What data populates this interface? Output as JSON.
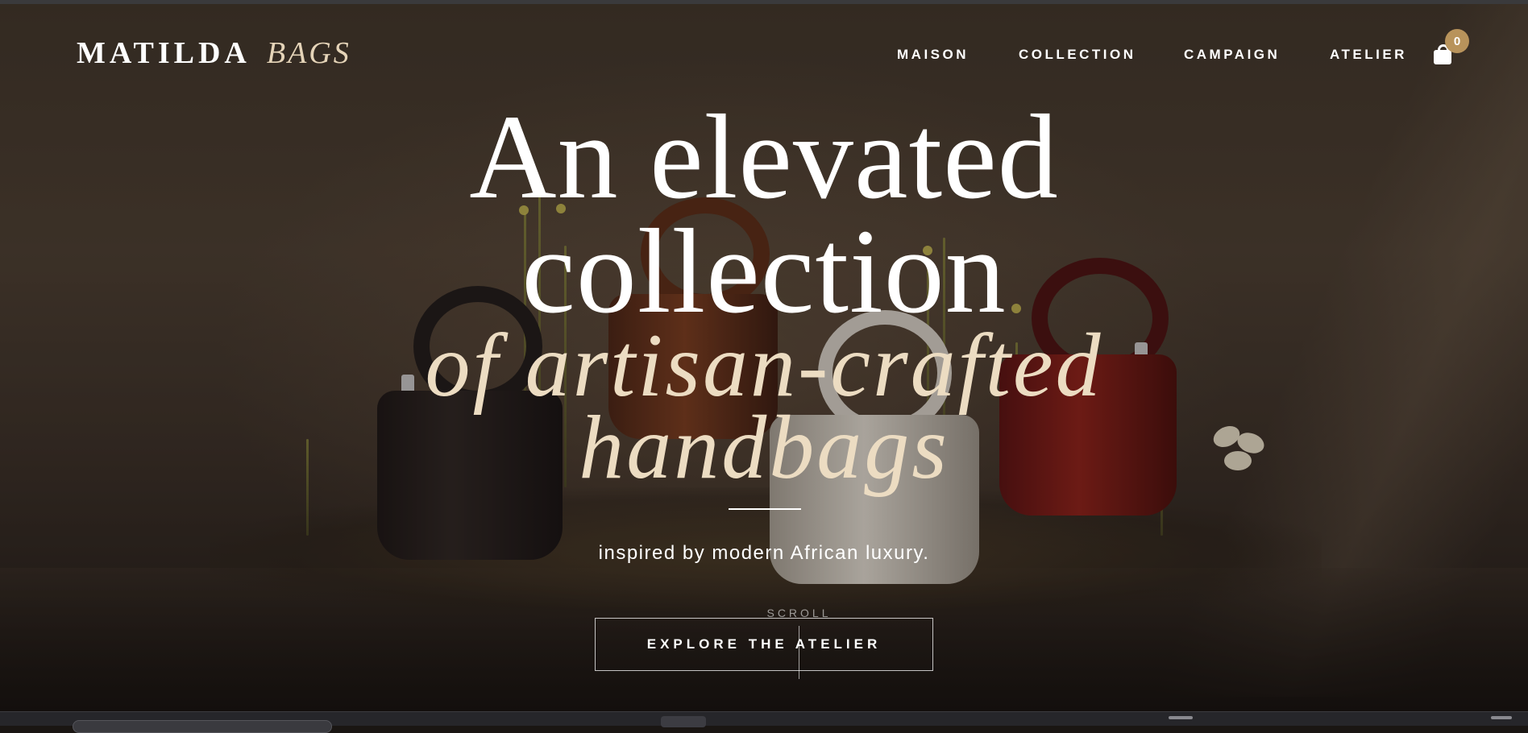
{
  "brand": {
    "name": "MATILDA",
    "sub": "BAGS"
  },
  "nav": {
    "items": [
      "MAISON",
      "COLLECTION",
      "CAMPAIGN",
      "ATELIER"
    ]
  },
  "cart": {
    "count": "0",
    "icon": "shopping-bag-icon"
  },
  "hero": {
    "line1": "An elevated",
    "line2": "collection",
    "line3": "of artisan-crafted",
    "line4": "handbags",
    "tagline": "inspired by modern African luxury.",
    "scroll_label": "SCROLL",
    "cta_label": "EXPLORE THE ATELIER"
  },
  "colors": {
    "accent": "#b8935b",
    "italic_text": "#ecdcc2",
    "background": "#1a1613"
  }
}
